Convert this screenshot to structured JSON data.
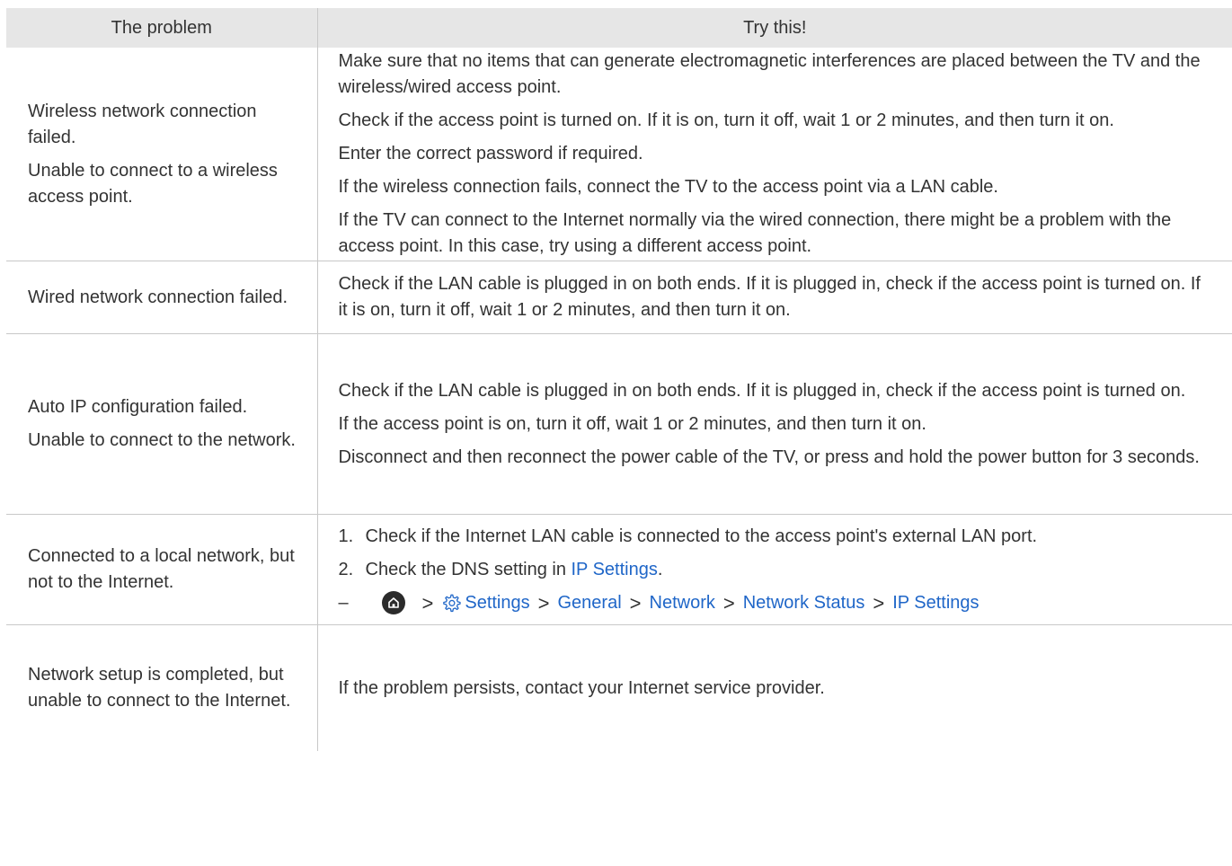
{
  "headers": {
    "problem": "The problem",
    "solution": "Try this!"
  },
  "rows": [
    {
      "problem": [
        "Wireless network connection failed.",
        "Unable to connect to a wireless access point."
      ],
      "solution": [
        "Make sure that no items that can generate electromagnetic interferences are placed between the TV and the wireless/wired access point.",
        "Check if the access point is turned on. If it is on, turn it off, wait 1 or 2 minutes, and then turn it on.",
        "Enter the correct password if required.",
        "If the wireless connection fails, connect the TV to the access point via a LAN cable.",
        "If the TV can connect to the Internet normally via the wired connection, there might be a problem with the access point. In this case, try using a different access point."
      ]
    },
    {
      "problem": [
        "Wired network connection failed."
      ],
      "solution": [
        "Check if the LAN cable is plugged in on both ends. If it is plugged in, check if the access point is turned on. If it is on, turn it off, wait 1 or 2 minutes, and then turn it on."
      ]
    },
    {
      "problem": [
        "Auto IP configuration failed.",
        "Unable to connect to the network."
      ],
      "solution": [
        "Check if the LAN cable is plugged in on both ends. If it is plugged in, check if the access point is turned on.",
        "If the access point is on, turn it off, wait 1 or 2 minutes, and then turn it on.",
        "Disconnect and then reconnect the power cable of the TV, or press and hold the power button for 3 seconds."
      ]
    },
    {
      "problem": [
        "Connected to a local network, but not to the Internet."
      ],
      "steps": [
        {
          "num": "1.",
          "text": "Check if the Internet LAN cable is connected to the access point's external LAN port."
        },
        {
          "num": "2.",
          "text": "Check the DNS setting in ",
          "link": "IP Settings",
          "suffix": "."
        }
      ],
      "path": {
        "dash": "–",
        "home_icon": "home-icon",
        "gear_icon": "gear-icon",
        "separator": ">",
        "items": [
          "Settings",
          "General",
          "Network",
          "Network Status",
          "IP Settings"
        ]
      }
    },
    {
      "problem": [
        "Network setup is completed, but unable to connect to the Internet."
      ],
      "solution": [
        "If the problem persists, contact your Internet service provider."
      ]
    }
  ],
  "colors": {
    "header_bg": "#e6e6e6",
    "link": "#1f66c8",
    "text": "#333333",
    "border": "#c8c8c8"
  }
}
